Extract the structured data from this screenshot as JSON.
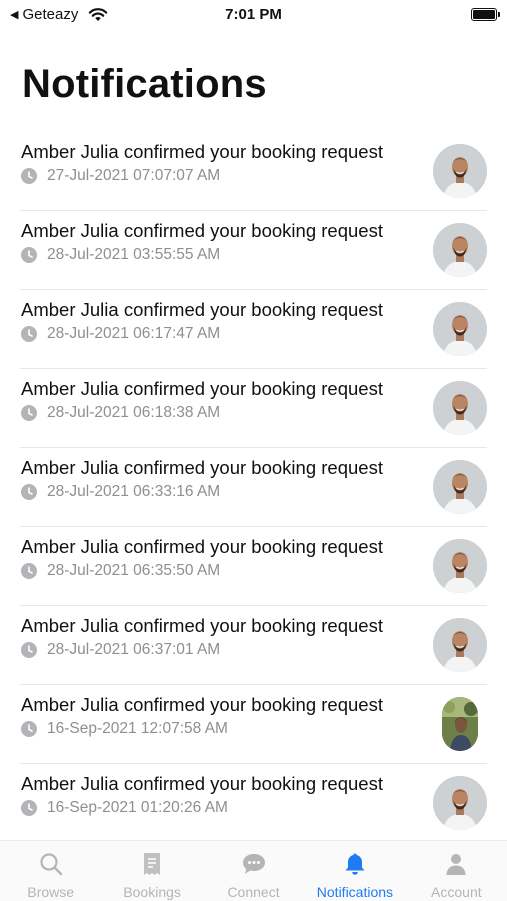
{
  "status_bar": {
    "back_app": "Geteazy",
    "time": "7:01 PM"
  },
  "page": {
    "title": "Notifications"
  },
  "notifications": [
    {
      "text": "Amber Julia confirmed your booking request",
      "timestamp": "27-Jul-2021 07:07:07 AM",
      "avatar": "man-avatar"
    },
    {
      "text": "Amber Julia confirmed your booking request",
      "timestamp": "28-Jul-2021 03:55:55 AM",
      "avatar": "man-avatar"
    },
    {
      "text": "Amber Julia confirmed your booking request",
      "timestamp": "28-Jul-2021 06:17:47 AM",
      "avatar": "man-avatar"
    },
    {
      "text": "Amber Julia confirmed your booking request",
      "timestamp": "28-Jul-2021 06:18:38 AM",
      "avatar": "man-avatar"
    },
    {
      "text": "Amber Julia confirmed your booking request",
      "timestamp": "28-Jul-2021 06:33:16 AM",
      "avatar": "man-avatar"
    },
    {
      "text": "Amber Julia confirmed your booking request",
      "timestamp": "28-Jul-2021 06:35:50 AM",
      "avatar": "man-avatar"
    },
    {
      "text": "Amber Julia confirmed your booking request",
      "timestamp": "28-Jul-2021 06:37:01 AM",
      "avatar": "man-avatar"
    },
    {
      "text": "Amber Julia confirmed your booking request",
      "timestamp": "16-Sep-2021 12:07:58 AM",
      "avatar": "outdoor-photo-avatar"
    },
    {
      "text": "Amber Julia confirmed your booking request",
      "timestamp": "16-Sep-2021 01:20:26 AM",
      "avatar": "man-avatar"
    }
  ],
  "tab_bar": {
    "tabs": [
      {
        "label": "Browse",
        "icon": "search-icon"
      },
      {
        "label": "Bookings",
        "icon": "receipt-icon"
      },
      {
        "label": "Connect",
        "icon": "chat-icon"
      },
      {
        "label": "Notifications",
        "icon": "bell-icon",
        "active": true
      },
      {
        "label": "Account",
        "icon": "person-icon"
      }
    ]
  },
  "colors": {
    "accent": "#1e7cf2",
    "inactive": "#b5b5b5",
    "secondary_text": "#8e8e93"
  }
}
